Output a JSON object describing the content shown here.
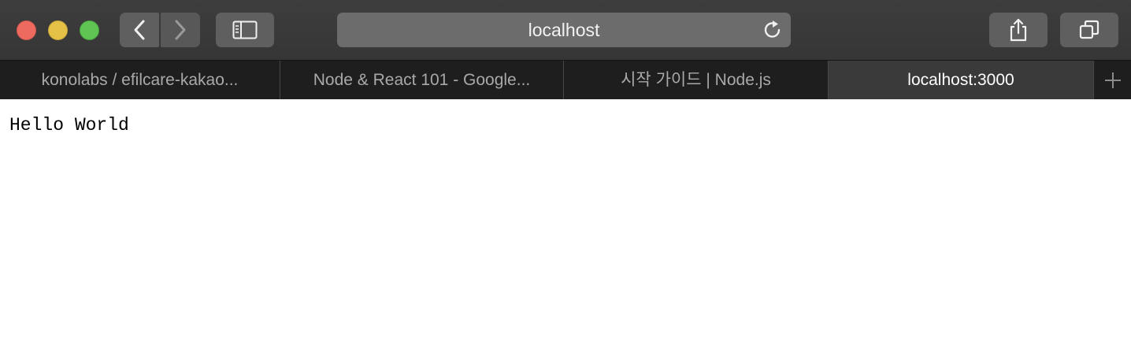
{
  "toolbar": {
    "address": "localhost",
    "icons": {
      "back": "chevron-left-icon",
      "forward": "chevron-right-icon",
      "sidebar": "sidebar-icon",
      "reload": "reload-icon",
      "share": "share-icon",
      "tabs": "tab-overview-icon"
    }
  },
  "tabs": [
    {
      "label": "konolabs / efilcare-kakao..."
    },
    {
      "label": "Node & React 101 - Google..."
    },
    {
      "label": "시작 가이드 | Node.js"
    },
    {
      "label": "localhost:3000",
      "active": true
    }
  ],
  "new_tab_icon": "plus-icon",
  "page": {
    "body_text": "Hello World"
  },
  "colors": {
    "close": "#ed6a5e",
    "minimize": "#e6c147",
    "maximize": "#5fc454"
  }
}
